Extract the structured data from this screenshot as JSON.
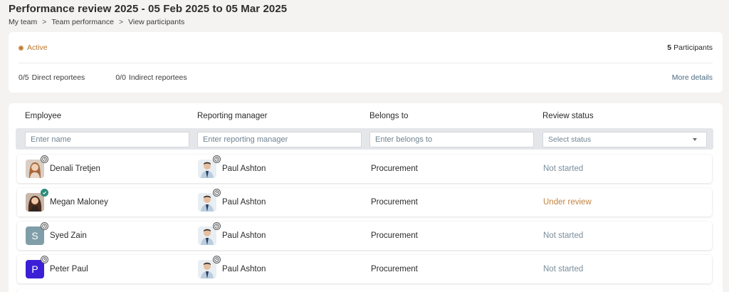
{
  "header": {
    "title": "Performance review 2025 - 05 Feb 2025 to 05 Mar 2025",
    "breadcrumbs": [
      "My team",
      "Team performance",
      "View participants"
    ],
    "breadcrumb_separator": ">"
  },
  "summary": {
    "status": "Active",
    "participants_count": "5",
    "participants_label": "Participants",
    "direct_count": "0/5",
    "direct_label": "Direct reportees",
    "indirect_count": "0/0",
    "indirect_label": "Indirect reportees",
    "more_details": "More details"
  },
  "table": {
    "columns": [
      "Employee",
      "Reporting manager",
      "Belongs to",
      "Review status"
    ],
    "filters": {
      "name_placeholder": "Enter name",
      "manager_placeholder": "Enter reporting manager",
      "belongs_placeholder": "Enter belongs to",
      "status_placeholder": "Select status"
    },
    "rows": [
      {
        "employee": "Denali Tretjen",
        "avatar": "photo",
        "badge": "clock-icon",
        "manager": "Paul Ashton",
        "belongs_to": "Procurement",
        "status": "Not started"
      },
      {
        "employee": "Megan Maloney",
        "avatar": "photo",
        "badge": "check-icon",
        "manager": "Paul Ashton",
        "belongs_to": "Procurement",
        "status": "Under review"
      },
      {
        "employee": "Syed Zain",
        "avatar": "S",
        "badge": "clock-icon",
        "manager": "Paul Ashton",
        "belongs_to": "Procurement",
        "status": "Not started"
      },
      {
        "employee": "Peter Paul",
        "avatar": "P",
        "badge": "clock-icon",
        "manager": "Paul Ashton",
        "belongs_to": "Procurement",
        "status": "Not started"
      }
    ]
  },
  "colors": {
    "active": "#b8772d",
    "not_started": "#7a8e9c",
    "under_review": "#c08340",
    "avatar_s": "#7f9ea8",
    "avatar_p": "#3b1fd6"
  }
}
